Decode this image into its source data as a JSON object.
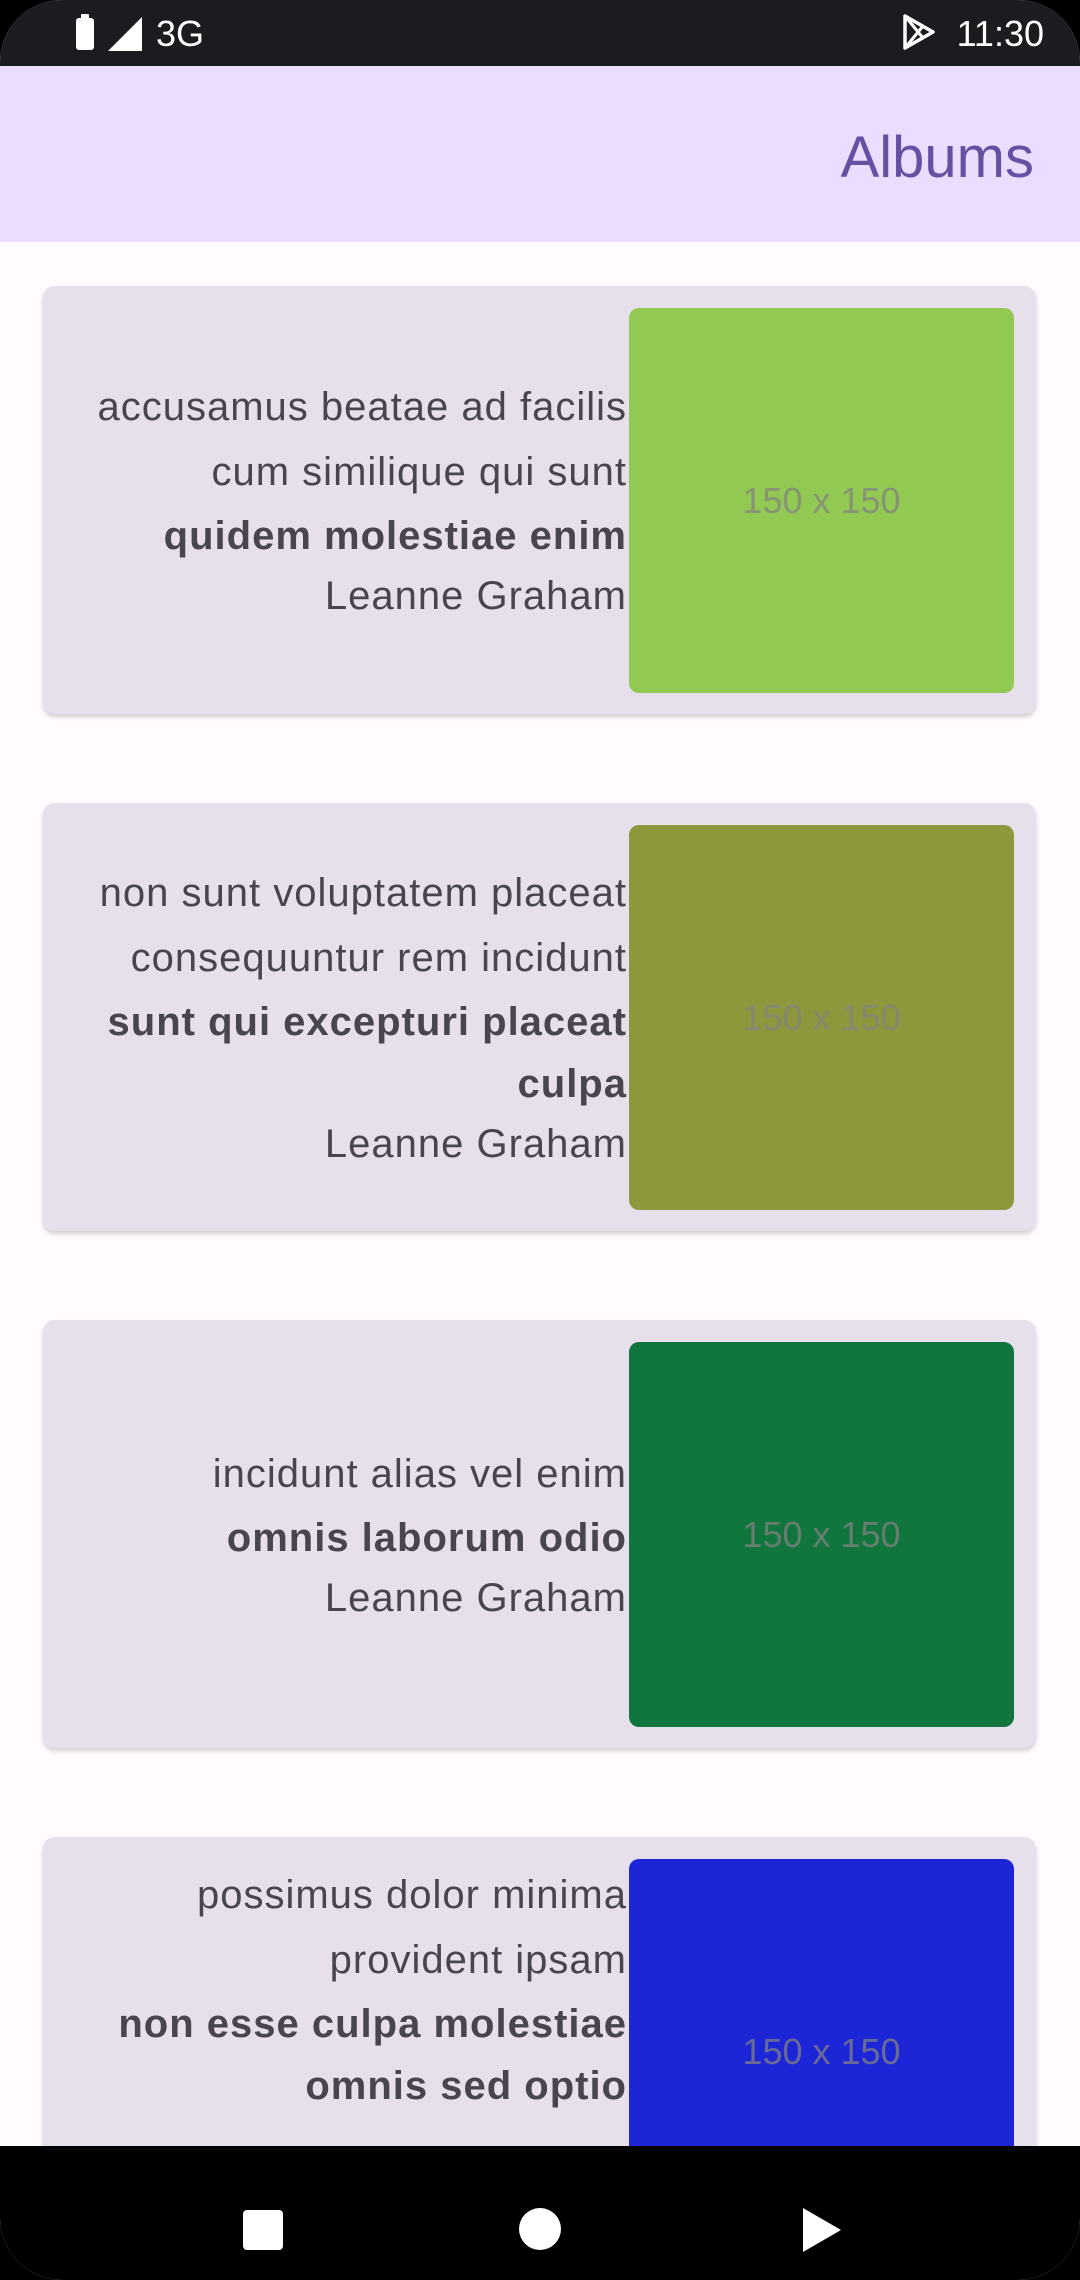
{
  "status_bar": {
    "network": "3G",
    "time": "11:30"
  },
  "app_bar": {
    "title": "Albums"
  },
  "albums": [
    {
      "title": "accusamus beatae ad facilis cum similique qui sunt",
      "subtitle": "quidem molestiae enim",
      "artist": "Leanne Graham",
      "thumb_label": "150 x 150",
      "thumb_color": "#92c952"
    },
    {
      "title": "non sunt voluptatem placeat consequuntur rem incidunt",
      "subtitle": "sunt qui excepturi placeat culpa",
      "artist": "Leanne Graham",
      "thumb_label": "150 x 150",
      "thumb_color": "#8e973b"
    },
    {
      "title": "incidunt alias vel enim",
      "subtitle": "omnis laborum odio",
      "artist": "Leanne Graham",
      "thumb_label": "150 x 150",
      "thumb_color": "#10763d"
    },
    {
      "title": "possimus dolor minima provident ipsam",
      "subtitle": "non esse culpa molestiae omnis sed optio",
      "artist": "",
      "thumb_label": "150 x 150",
      "thumb_color": "#1c26d6"
    }
  ],
  "icons": {
    "battery": "battery-icon",
    "signal": "signal-icon",
    "play_store": "play-store-icon",
    "nav_recents": "recents-square-icon",
    "nav_home": "home-circle-icon",
    "nav_back": "back-triangle-icon"
  }
}
